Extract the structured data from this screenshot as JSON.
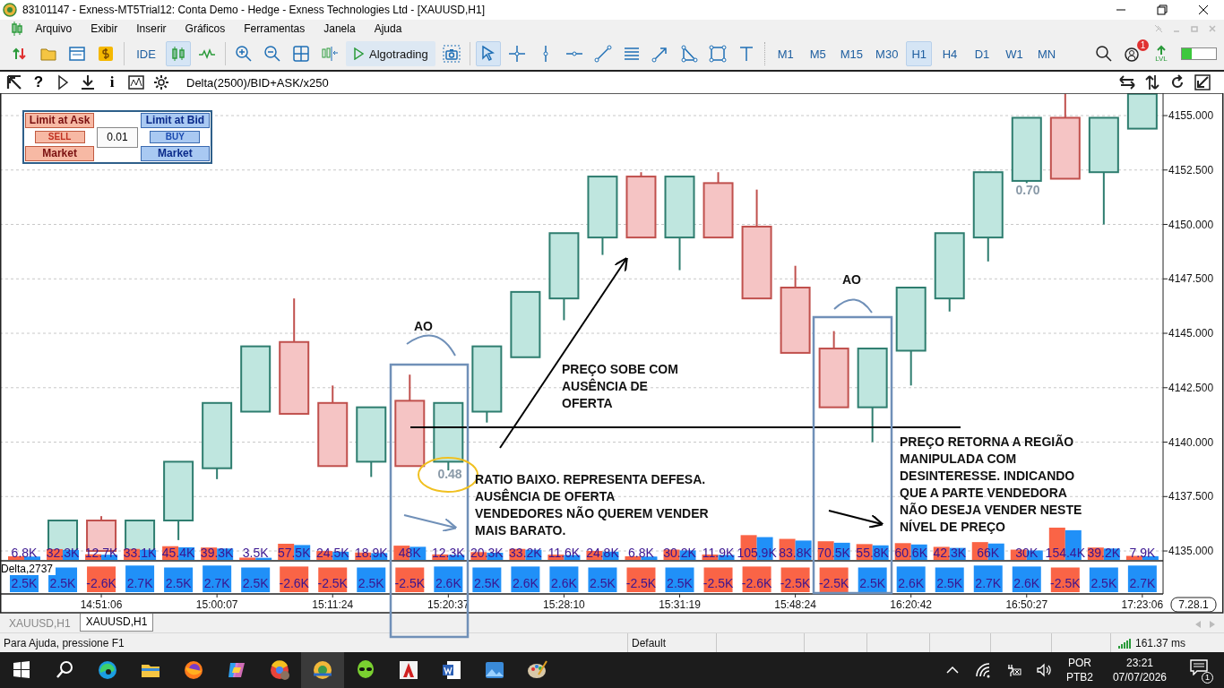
{
  "window": {
    "title": "83101147 - Exness-MT5Trial12: Conta Demo - Hedge - Exness Technologies Ltd - [XAUUSD,H1]"
  },
  "menu": [
    {
      "label": "Arquivo"
    },
    {
      "label": "Exibir"
    },
    {
      "label": "Inserir"
    },
    {
      "label": "Gráficos"
    },
    {
      "label": "Ferramentas"
    },
    {
      "label": "Janela"
    },
    {
      "label": "Ajuda"
    }
  ],
  "toolbar": {
    "ide": "IDE",
    "algotrading": "Algotrading",
    "timeframes": [
      {
        "label": "M1",
        "selected": false
      },
      {
        "label": "M5",
        "selected": false
      },
      {
        "label": "M15",
        "selected": false
      },
      {
        "label": "M30",
        "selected": false
      },
      {
        "label": "H1",
        "selected": true
      },
      {
        "label": "H4",
        "selected": false
      },
      {
        "label": "D1",
        "selected": false
      },
      {
        "label": "W1",
        "selected": false
      },
      {
        "label": "MN",
        "selected": false
      }
    ],
    "notifications": "1",
    "lvl": "LVL",
    "connection": {
      "level": 0.3
    }
  },
  "chart_header": {
    "help": "?",
    "info": "i",
    "indicator": "Delta(2500)/BID+ASK/x250"
  },
  "trade_panel": {
    "sell": {
      "limit": "Limit at Ask",
      "side": "SELL",
      "market": "Market"
    },
    "volume": "0.01",
    "buy": {
      "limit": "Limit at Bid",
      "side": "BUY",
      "market": "Market"
    }
  },
  "chart": {
    "delta_title": "Delta,2737",
    "version": "7.28.1",
    "price_labels": [
      "4155.000",
      "4152.500",
      "4150.000",
      "4147.500",
      "4145.000",
      "4142.500",
      "4140.000",
      "4137.500",
      "4135.000"
    ],
    "time_labels": [
      "14:51:06",
      "15:00:07",
      "15:11:24",
      "15:20:37",
      "15:28:10",
      "15:31:19",
      "15:48:24",
      "16:20:42",
      "16:50:27",
      "17:23:06"
    ],
    "bars": [
      {
        "volume": "6.8K",
        "delta": "2.5K",
        "kind": "buy"
      },
      {
        "volume": "32.3K",
        "delta": "2.5K",
        "kind": "buy"
      },
      {
        "volume": "12.7K",
        "delta": "-2.6K",
        "kind": "sell"
      },
      {
        "volume": "33.1K",
        "delta": "2.7K",
        "kind": "buy"
      },
      {
        "volume": "45.4K",
        "delta": "2.5K",
        "kind": "buy"
      },
      {
        "volume": "39.3K",
        "delta": "2.7K",
        "kind": "buy"
      },
      {
        "volume": "3.5K",
        "delta": "2.5K",
        "kind": "buy"
      },
      {
        "volume": "57.5K",
        "delta": "-2.6K",
        "kind": "sell"
      },
      {
        "volume": "24.5K",
        "delta": "-2.5K",
        "kind": "sell"
      },
      {
        "volume": "18.9K",
        "delta": "2.5K",
        "kind": "buy"
      },
      {
        "volume": "48K",
        "delta": "-2.5K",
        "kind": "sell"
      },
      {
        "volume": "12.3K",
        "delta": "2.6K",
        "kind": "buy"
      },
      {
        "volume": "20.3K",
        "delta": "2.5K",
        "kind": "buy"
      },
      {
        "volume": "33.2K",
        "delta": "2.6K",
        "kind": "buy"
      },
      {
        "volume": "11.6K",
        "delta": "2.6K",
        "kind": "buy"
      },
      {
        "volume": "24.8K",
        "delta": "2.5K",
        "kind": "buy"
      },
      {
        "volume": "6.8K",
        "delta": "-2.5K",
        "kind": "sell"
      },
      {
        "volume": "30.2K",
        "delta": "2.5K",
        "kind": "buy"
      },
      {
        "volume": "11.9K",
        "delta": "-2.5K",
        "kind": "sell"
      },
      {
        "volume": "105.9K",
        "delta": "-2.6K",
        "kind": "sell"
      },
      {
        "volume": "83.8K",
        "delta": "-2.5K",
        "kind": "sell"
      },
      {
        "volume": "70.5K",
        "delta": "-2.5K",
        "kind": "sell"
      },
      {
        "volume": "55.8K",
        "delta": "2.5K",
        "kind": "buy"
      },
      {
        "volume": "60.6K",
        "delta": "2.6K",
        "kind": "buy"
      },
      {
        "volume": "42.3K",
        "delta": "2.5K",
        "kind": "buy"
      },
      {
        "volume": "66K",
        "delta": "2.7K",
        "kind": "buy"
      },
      {
        "volume": "30K",
        "delta": "2.6K",
        "kind": "buy"
      },
      {
        "volume": "154.4K",
        "delta": "-2.5K",
        "kind": "sell"
      },
      {
        "volume": "39.2K",
        "delta": "2.5K",
        "kind": "buy"
      },
      {
        "volume": "7.9K",
        "delta": "2.7K",
        "kind": "buy"
      }
    ],
    "ratios": [
      "0.48",
      "0.70"
    ],
    "annotations": [
      {
        "lines": [
          "AO"
        ]
      },
      {
        "lines": [
          "AO"
        ]
      },
      {
        "lines": [
          "PREÇO SOBE COM",
          "AUSÊNCIA DE",
          "OFERTA"
        ]
      },
      {
        "lines": [
          "RATIO BAIXO. REPRESENTA DEFESA.",
          "AUSÊNCIA DE OFERTA",
          "VENDEDORES NÃO QUEREM VENDER",
          "MAIS BARATO."
        ]
      },
      {
        "lines": [
          "PREÇO RETORNA A REGIÃO",
          "MANIPULADA COM",
          "DESINTERESSE. INDICANDO",
          "QUE A PARTE VENDEDORA",
          "NÃO DESEJA VENDER NESTE",
          "NÍVEL DE PREÇO"
        ]
      }
    ]
  },
  "tabs": [
    {
      "label": "XAUUSD,H1",
      "selected": false
    },
    {
      "label": "XAUUSD,H1",
      "selected": true
    }
  ],
  "status_bar": {
    "help": "Para Ajuda, pressione F1",
    "profile": "Default",
    "ping": "161.37 ms"
  },
  "taskbar": {
    "language": "POR",
    "layout": "PTB2",
    "time": "23:21",
    "date": "07/07/2026",
    "notifications": "1"
  }
}
